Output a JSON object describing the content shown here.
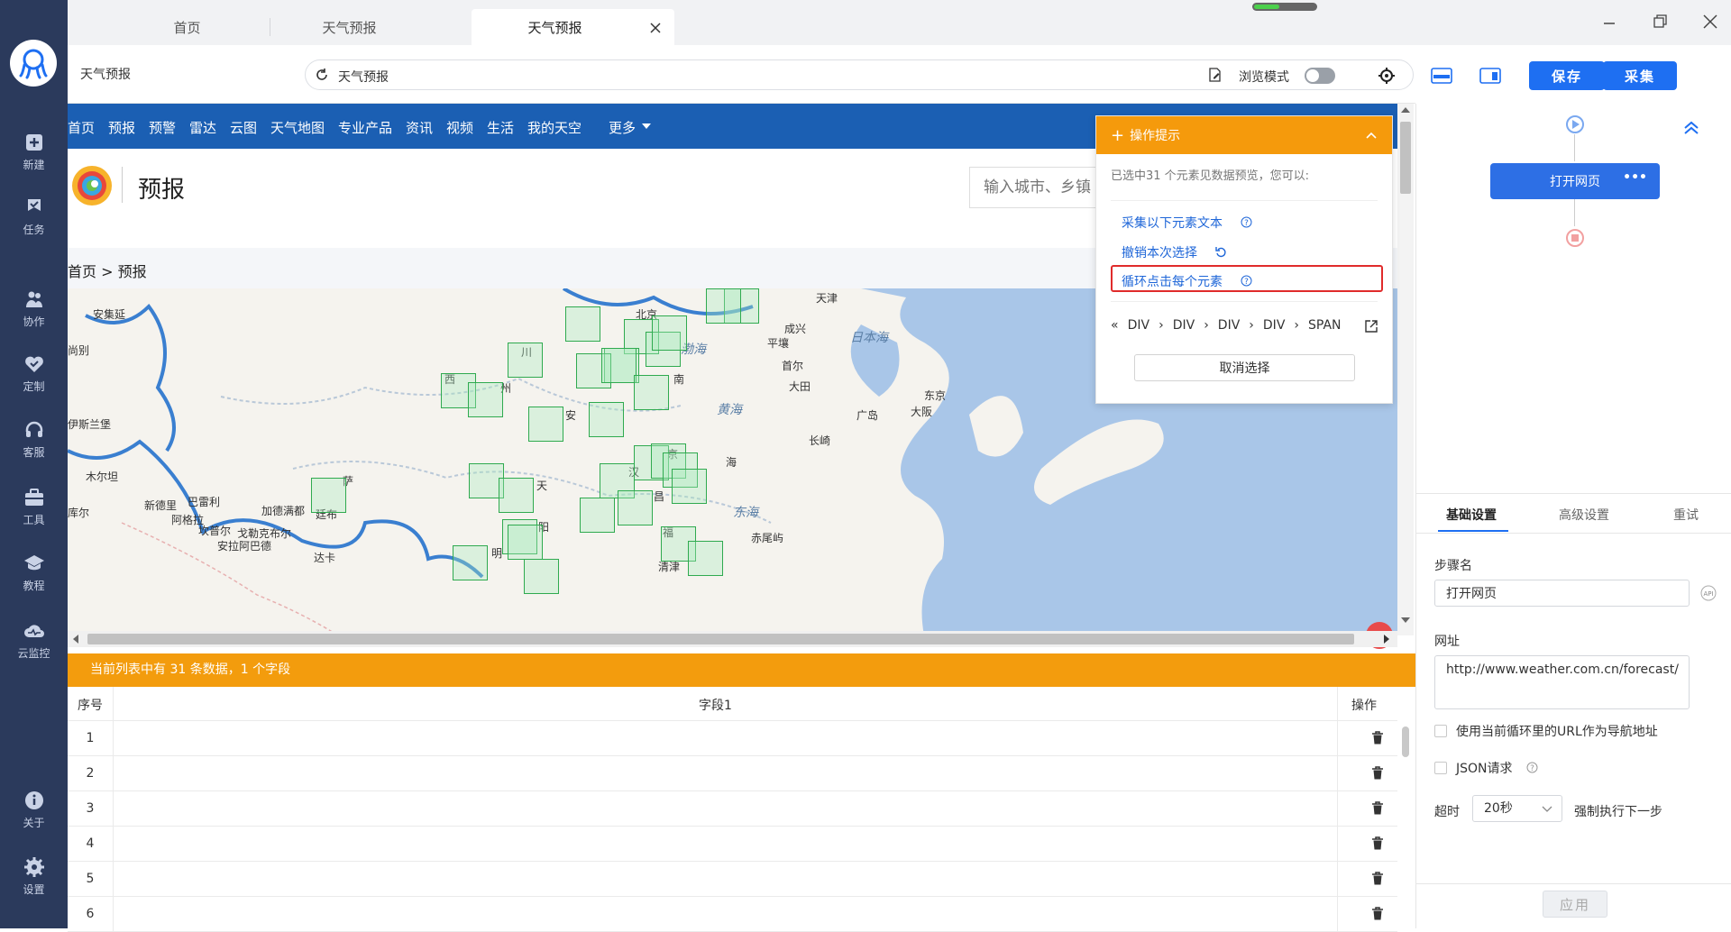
{
  "sidebar": {
    "items": [
      {
        "label": "新建",
        "icon": "plus-square-icon"
      },
      {
        "label": "任务",
        "icon": "flag-icon"
      },
      {
        "label": "协作",
        "icon": "people-icon"
      },
      {
        "label": "定制",
        "icon": "heart-check-icon"
      },
      {
        "label": "客服",
        "icon": "headset-icon"
      },
      {
        "label": "工具",
        "icon": "toolbox-icon"
      },
      {
        "label": "教程",
        "icon": "graduation-cap-icon"
      },
      {
        "label": "云监控",
        "icon": "cloud-monitor-icon"
      },
      {
        "label": "关于",
        "icon": "info-icon"
      },
      {
        "label": "设置",
        "icon": "gear-icon"
      }
    ]
  },
  "tabs": [
    {
      "label": "首页"
    },
    {
      "label": "天气预报"
    },
    {
      "label": "天气预报",
      "active": true
    }
  ],
  "addressbar": {
    "title": "天气预报",
    "url": "天气预报",
    "browse_mode_label": "浏览模式",
    "save_label": "保存",
    "collect_label": "采集"
  },
  "site": {
    "nav": [
      "首页",
      "预报",
      "预警",
      "雷达",
      "云图",
      "天气地图",
      "专业产品",
      "资讯",
      "视频",
      "生活",
      "我的天空",
      "更多"
    ],
    "page_title": "预报",
    "search_placeholder": "输入城市、乡镇",
    "breadcrumb": "首页 > 预报"
  },
  "map": {
    "labels": [
      {
        "t": "安集延"
      },
      {
        "t": "尚别"
      },
      {
        "t": "伊斯兰堡"
      },
      {
        "t": "木尔坦"
      },
      {
        "t": "新德里"
      },
      {
        "t": "巴雷利"
      },
      {
        "t": "阿格拉"
      },
      {
        "t": "坎普尔"
      },
      {
        "t": "戈勒克布尔"
      },
      {
        "t": "加德满都"
      },
      {
        "t": "安拉阿巴德"
      },
      {
        "t": "廷布"
      },
      {
        "t": "达卡"
      },
      {
        "t": "库尔"
      },
      {
        "t": "北京"
      },
      {
        "t": "天津"
      },
      {
        "t": "成兴"
      },
      {
        "t": "平壤"
      },
      {
        "t": "首尔"
      },
      {
        "t": "大田"
      },
      {
        "t": "渤海"
      },
      {
        "t": "黄海"
      },
      {
        "t": "东海"
      },
      {
        "t": "日本海"
      },
      {
        "t": "东京"
      },
      {
        "t": "大阪"
      },
      {
        "t": "广岛"
      },
      {
        "t": "长崎"
      },
      {
        "t": "赤尾屿"
      },
      {
        "t": "清津"
      },
      {
        "t": "南"
      },
      {
        "t": "安"
      },
      {
        "t": "汉"
      },
      {
        "t": "天"
      },
      {
        "t": "阳"
      },
      {
        "t": "明"
      },
      {
        "t": "福"
      },
      {
        "t": "昌"
      },
      {
        "t": "海"
      },
      {
        "t": "川"
      },
      {
        "t": "萨"
      },
      {
        "t": "西"
      },
      {
        "t": "州"
      },
      {
        "t": "京"
      }
    ],
    "highlight_count": 31
  },
  "popup": {
    "title": "操作提示",
    "desc": "已选中31 个元素见数据预览，您可以:",
    "links": [
      "采集以下元素文本",
      "撤销本次选择",
      "循环点击每个元素"
    ],
    "path": [
      "DIV",
      "DIV",
      "DIV",
      "DIV",
      "SPAN"
    ],
    "cancel_label": "取消选择"
  },
  "databar": {
    "text": "当前列表中有 31 条数据，1 个字段"
  },
  "table": {
    "headers": [
      "序号",
      "字段1",
      "操作"
    ],
    "rows": [
      "1",
      "2",
      "3",
      "4",
      "5",
      "6"
    ]
  },
  "rightpanel": {
    "flow_step": "打开网页",
    "tabs": [
      "基础设置",
      "高级设置",
      "重试"
    ],
    "step_name_label": "步骤名",
    "step_name_value": "打开网页",
    "url_label": "网址",
    "url_value": "http://www.weather.com.cn/forecast/",
    "use_loop_url_label": "使用当前循环里的URL作为导航地址",
    "json_label": "JSON请求",
    "timeout_label": "超时",
    "timeout_value": "20秒",
    "force_next_label": "强制执行下一步",
    "apply_label": "应用"
  },
  "colors": {
    "sidebar": "#2b3a5c",
    "accent": "#1e6ff2",
    "orange": "#f39c0d",
    "site_nav": "#1b5fb3",
    "highlight": "#2faa4f",
    "red": "#e02b2b"
  }
}
